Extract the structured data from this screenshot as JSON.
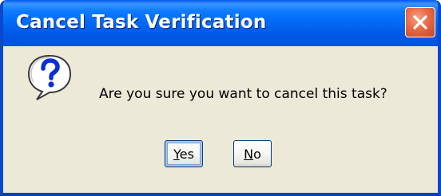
{
  "window": {
    "title": "Cancel Task Verification",
    "close_icon": "close-icon"
  },
  "dialog": {
    "icon": "question-icon",
    "message": "Are you sure you want to cancel this task?"
  },
  "buttons": {
    "yes": {
      "mnemonic": "Y",
      "rest": "es"
    },
    "no": {
      "mnemonic": "N",
      "rest": "o"
    }
  },
  "colors": {
    "titlebar": "#0054e3",
    "close_button": "#e76a44",
    "dialog_background": "#ece9d8",
    "question_icon": "#0a2fd6"
  }
}
